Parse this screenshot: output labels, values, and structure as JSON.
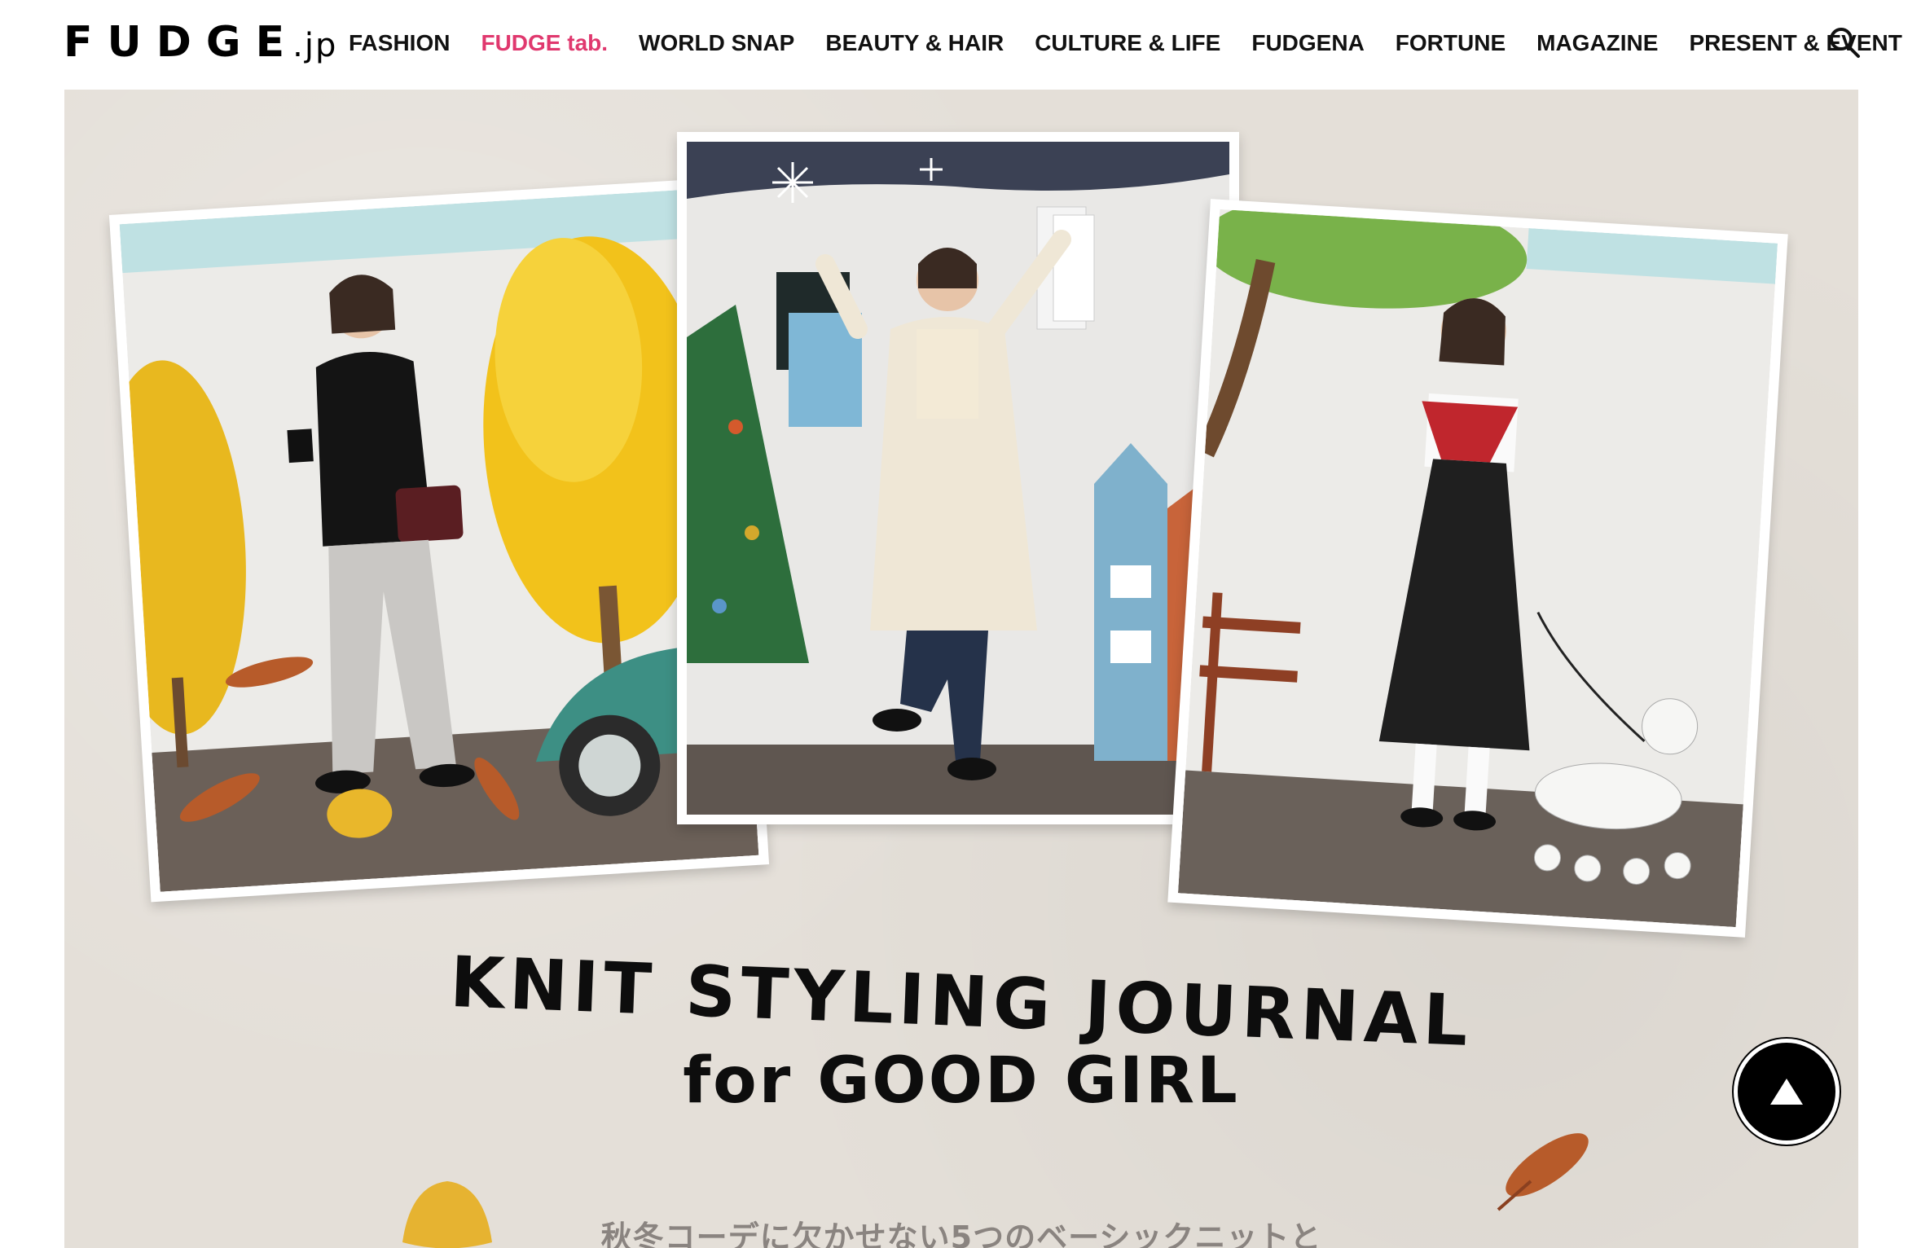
{
  "header": {
    "logo_main": "FUDGE",
    "logo_suffix": ".jp",
    "nav": [
      {
        "label": "FASHION",
        "active": false
      },
      {
        "label": "FUDGE tab.",
        "active": true
      },
      {
        "label": "WORLD SNAP",
        "active": false
      },
      {
        "label": "BEAUTY & HAIR",
        "active": false
      },
      {
        "label": "CULTURE & LIFE",
        "active": false
      },
      {
        "label": "FUDGENA",
        "active": false
      },
      {
        "label": "FORTUNE",
        "active": false
      },
      {
        "label": "MAGAZINE",
        "active": false
      },
      {
        "label": "PRESENT & EVENT",
        "active": false
      }
    ],
    "search_icon": "search-icon"
  },
  "hero": {
    "headline_line1": "KNIT STYLING JOURNAL",
    "headline_line2": "for GOOD GIRL",
    "subtitle": "秋冬コーデに欠かせない5つのベーシックニットと",
    "photos": [
      {
        "name": "autumn-photo",
        "scene": "autumn ginkgo trees and green car"
      },
      {
        "name": "christmas-photo",
        "scene": "snowy Christmas shopping street"
      },
      {
        "name": "spring-photo",
        "scene": "park bench with poodle"
      }
    ]
  },
  "scroll_top": {
    "icon": "triangle-up-icon"
  },
  "colors": {
    "accent": "#e0386e",
    "text": "#111111",
    "background": "#e4dfd8"
  }
}
